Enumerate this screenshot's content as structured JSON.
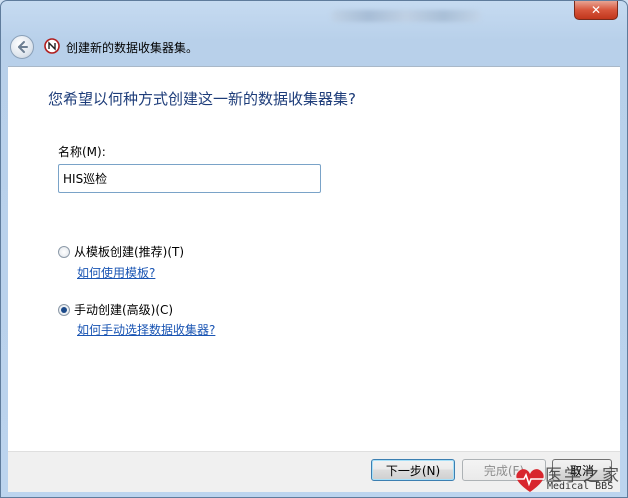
{
  "window": {
    "close_glyph": "✕"
  },
  "wizard": {
    "title": "创建新的数据收集器集。",
    "heading": "您希望以何种方式创建这一新的数据收集器集?"
  },
  "form": {
    "name_label": "名称(M):",
    "name_value": "HIS巡检",
    "options": [
      {
        "label": "从模板创建(推荐)(T)",
        "help": "如何使用模板?",
        "selected": false
      },
      {
        "label": "手动创建(高级)(C)",
        "help": "如何手动选择数据收集器?",
        "selected": true
      }
    ]
  },
  "footer": {
    "next_label": "下一步(N)",
    "finish_label": "完成(F)",
    "cancel_label": "取消"
  },
  "watermark": {
    "text": "医学之家",
    "sub": "Medical BBS"
  },
  "colors": {
    "heading": "#1e3d7a",
    "link": "#1a55b3",
    "close": "#c1361c"
  }
}
